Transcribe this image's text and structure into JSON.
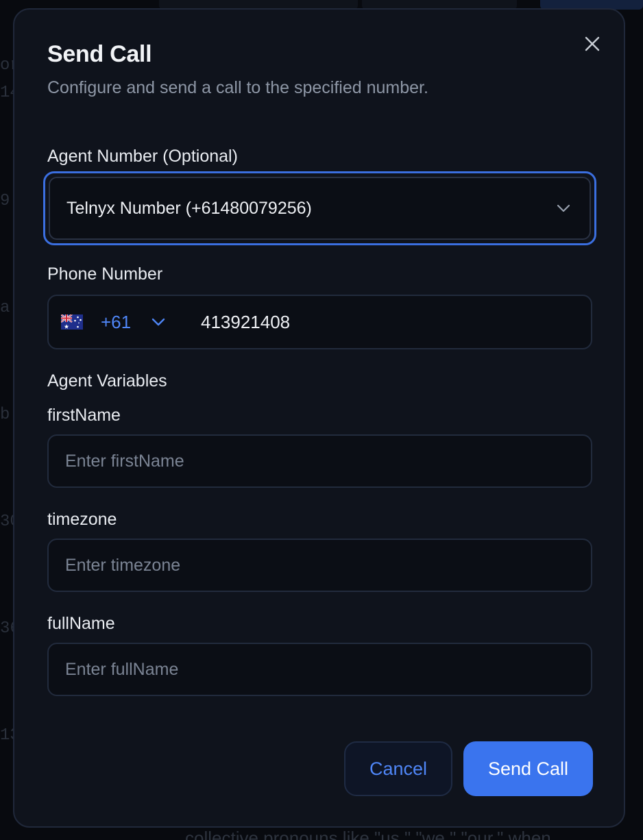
{
  "dialog": {
    "title": "Send Call",
    "subtitle": "Configure and send a call to the specified number."
  },
  "agent_number": {
    "label": "Agent Number (Optional)",
    "selected": "Telnyx Number (+61480079256)"
  },
  "phone_number": {
    "label": "Phone Number",
    "country_code": "+61",
    "country_flag": "australia-flag-icon",
    "value": "413921408"
  },
  "agent_variables": {
    "heading": "Agent Variables",
    "fields": [
      {
        "label": "firstName",
        "placeholder": "Enter firstName",
        "value": ""
      },
      {
        "label": "timezone",
        "placeholder": "Enter timezone",
        "value": ""
      },
      {
        "label": "fullName",
        "placeholder": "Enter fullName",
        "value": ""
      }
    ]
  },
  "actions": {
    "cancel_label": "Cancel",
    "send_label": "Send Call"
  },
  "colors": {
    "accent": "#3a74ee",
    "focus_ring": "#3b6fe0",
    "panel": "#0f131c",
    "link_blue": "#4f86f7"
  }
}
